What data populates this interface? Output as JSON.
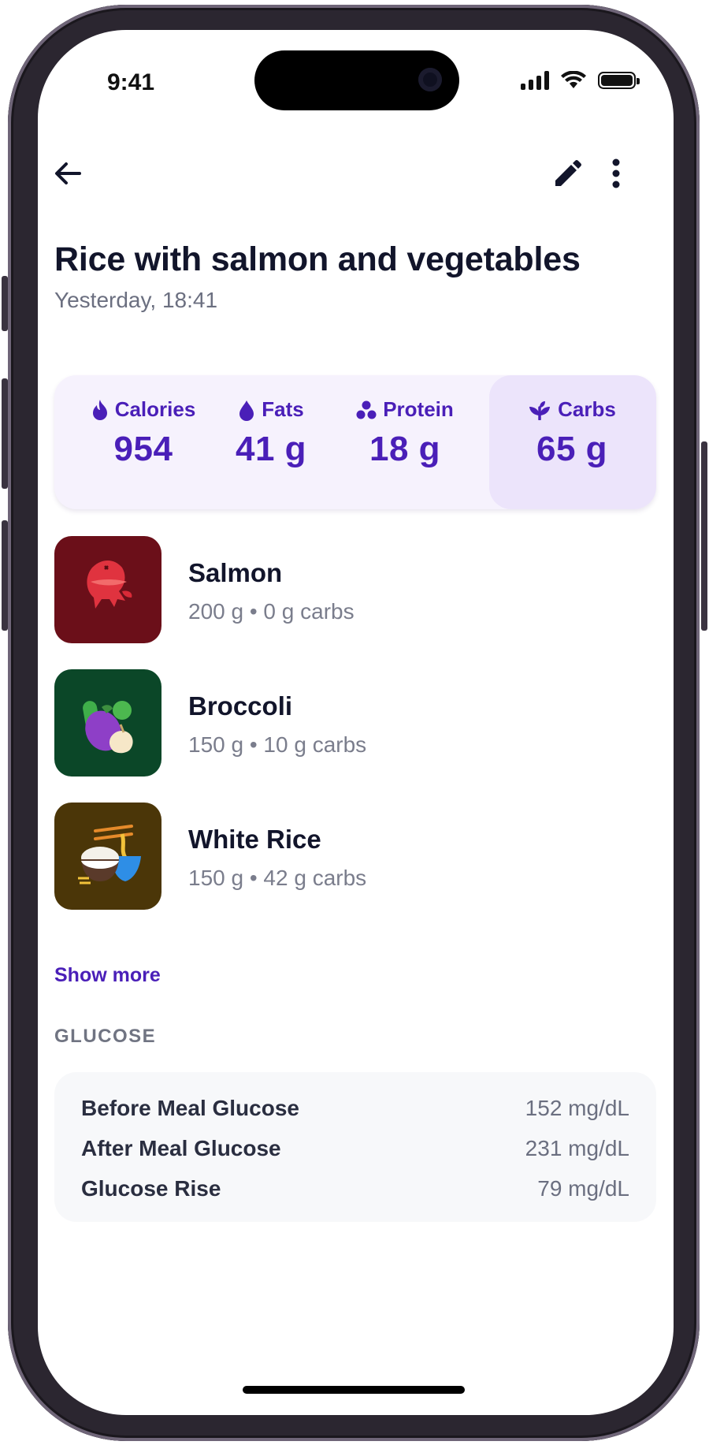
{
  "status_bar": {
    "time": "9:41"
  },
  "header": {
    "back_icon": "arrow-left-icon",
    "edit_icon": "pencil-icon",
    "more_icon": "more-vertical-icon"
  },
  "meal": {
    "title": "Rice with salmon and vegetables",
    "timestamp": "Yesterday, 18:41"
  },
  "macros": [
    {
      "label": "Calories",
      "value": "954",
      "icon": "flame-icon"
    },
    {
      "label": "Fats",
      "value": "41 g",
      "icon": "droplet-icon"
    },
    {
      "label": "Protein",
      "value": "18 g",
      "icon": "molecule-icon"
    },
    {
      "label": "Carbs",
      "value": "65 g",
      "icon": "sprout-icon",
      "selected": true
    }
  ],
  "foods": [
    {
      "name": "Salmon",
      "meta": "200 g • 0 g carbs",
      "thumb_color": "#6b0f19",
      "icon": "fish-icon"
    },
    {
      "name": "Broccoli",
      "meta": "150 g • 10 g carbs",
      "thumb_color": "#0b4728",
      "icon": "vegetables-icon"
    },
    {
      "name": "White Rice",
      "meta": "150 g • 42 g carbs",
      "thumb_color": "#4b3608",
      "icon": "rice-bowl-icon"
    }
  ],
  "show_more_label": "Show more",
  "glucose": {
    "heading": "GLUCOSE",
    "rows": [
      {
        "label": "Before Meal Glucose",
        "value": "152 mg/dL"
      },
      {
        "label": "After Meal Glucose",
        "value": "231 mg/dL"
      },
      {
        "label": "Glucose Rise",
        "value": "79 mg/dL"
      }
    ]
  },
  "colors": {
    "accent": "#4a1fb8",
    "macro_card_bg": "#f6f2fd",
    "macro_selected_bg": "#ece4fb",
    "glucose_card_bg": "#f7f8fa"
  }
}
